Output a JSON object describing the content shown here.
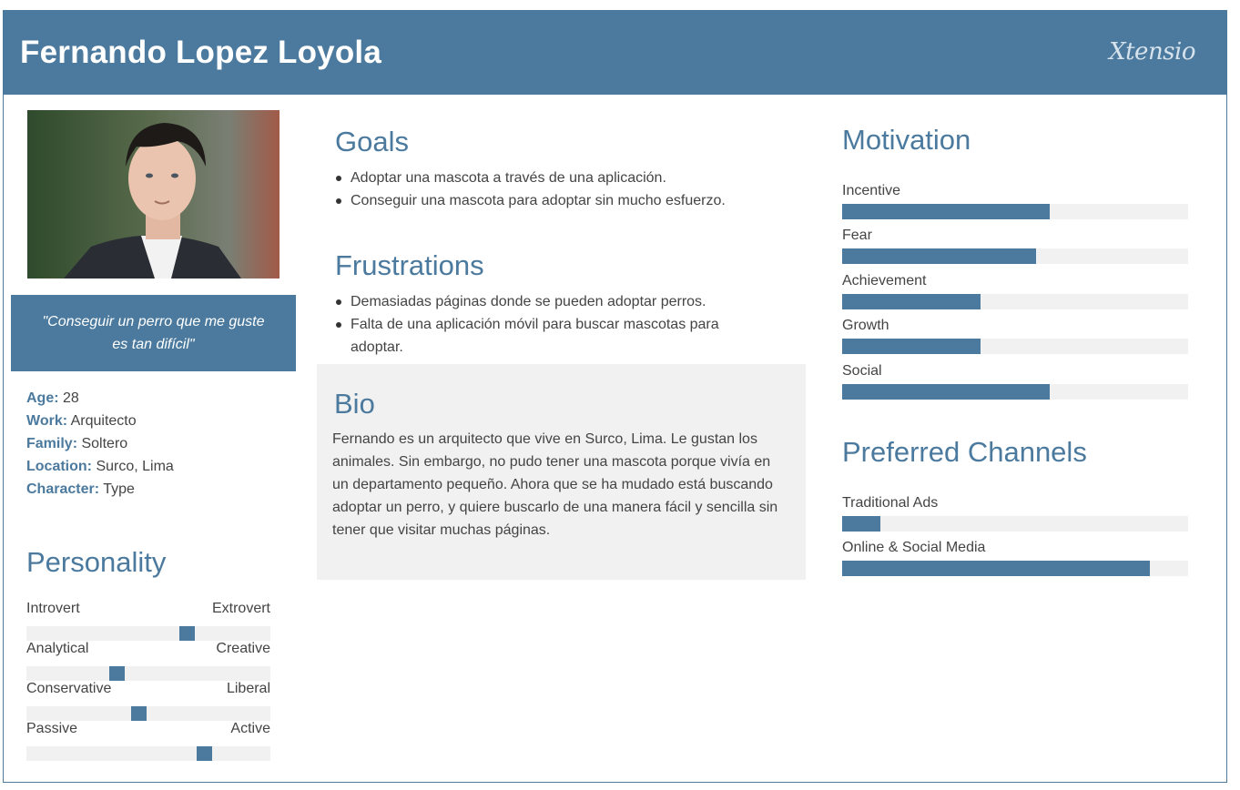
{
  "header": {
    "title": "Fernando Lopez Loyola",
    "brand": "Xtensio"
  },
  "profile": {
    "quote": "\"Conseguir un perro que me guste es tan difícil\"",
    "info": [
      {
        "label": "Age:",
        "value": "28"
      },
      {
        "label": "Work:",
        "value": "Arquitecto"
      },
      {
        "label": "Family:",
        "value": "Soltero"
      },
      {
        "label": "Location:",
        "value": "Surco, Lima"
      },
      {
        "label": "Character:",
        "value": "Type"
      }
    ]
  },
  "personality": {
    "heading": "Personality",
    "sliders": [
      {
        "left": "Introvert",
        "right": "Extrovert",
        "level": 0.66
      },
      {
        "left": "Analytical",
        "right": "Creative",
        "level": 0.37
      },
      {
        "left": "Conservative",
        "right": "Liberal",
        "level": 0.46
      },
      {
        "left": "Passive",
        "right": "Active",
        "level": 0.73
      }
    ]
  },
  "goals": {
    "heading": "Goals",
    "items": [
      "Adoptar una mascota a través de una aplicación.",
      "Conseguir una mascota para adoptar sin mucho esfuerzo."
    ]
  },
  "frustrations": {
    "heading": "Frustrations",
    "items": [
      "Demasiadas páginas donde se pueden adoptar perros.",
      "Falta de una aplicación móvil para buscar mascotas para adoptar."
    ]
  },
  "bio": {
    "heading": "Bio",
    "text": "Fernando es un arquitecto que vive en Surco, Lima. Le gustan los animales. Sin embargo, no pudo tener una mascota porque vivía en un departamento pequeño. Ahora que se ha mudado está buscando adoptar un perro, y quiere buscarlo de una manera fácil y sencilla sin tener que visitar muchas páginas."
  },
  "motivation": {
    "heading": "Motivation",
    "bars": [
      {
        "label": "Incentive",
        "level": 0.6
      },
      {
        "label": "Fear",
        "level": 0.56
      },
      {
        "label": "Achievement",
        "level": 0.4
      },
      {
        "label": "Growth",
        "level": 0.4
      },
      {
        "label": "Social",
        "level": 0.6
      }
    ]
  },
  "channels": {
    "heading": "Preferred Channels",
    "bars": [
      {
        "label": "Traditional Ads",
        "level": 0.11
      },
      {
        "label": "Online & Social Media",
        "level": 0.89
      }
    ]
  },
  "colors": {
    "accent": "#4b7a9e",
    "track": "#f1f1f1",
    "text": "#444444"
  }
}
